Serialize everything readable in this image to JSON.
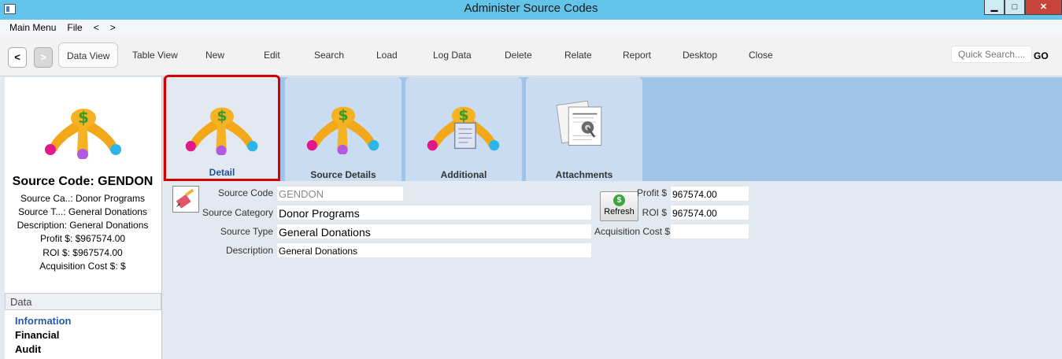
{
  "window": {
    "title": "Administer Source Codes",
    "minimize_glyph": "▁",
    "maximize_glyph": "□",
    "close_glyph": "✕"
  },
  "menubar": {
    "items": [
      "Main Menu",
      "File",
      "<",
      ">"
    ]
  },
  "toolbar": {
    "back_glyph": "<",
    "forward_glyph": ">",
    "data_view": "Data View",
    "table_view": "Table View",
    "new": "New",
    "edit": "Edit",
    "search": "Search",
    "load": "Load",
    "log_data": "Log Data",
    "delete": "Delete",
    "relate": "Relate",
    "report": "Report",
    "desktop": "Desktop",
    "close": "Close",
    "quick_search_placeholder": "Quick Search....",
    "go": "GO"
  },
  "summary": {
    "title": "Source Code: GENDON",
    "lines": [
      "Source Ca..: Donor Programs",
      "Source T...: General Donations",
      "Description: General Donations",
      "Profit $: $967574.00",
      "ROI $: $967574.00",
      "Acquisition Cost $: $"
    ]
  },
  "data_section": {
    "heading": "Data",
    "links": [
      "Information",
      "Financial",
      "Audit"
    ]
  },
  "tabs": [
    "Detail",
    "Source Details",
    "Additional",
    "Attachments"
  ],
  "form": {
    "source_code_label": "Source Code",
    "source_code_value": "GENDON",
    "source_category_label": "Source Category",
    "source_category_value": "Donor Programs",
    "source_type_label": "Source Type",
    "source_type_value": "General Donations",
    "description_label": "Description",
    "description_value": "General Donations",
    "refresh_label": "Refresh",
    "refresh_glyph": "$",
    "profit_label": "Profit $",
    "profit_value": "967574.00",
    "roi_label": "ROI $",
    "roi_value": "967574.00",
    "acq_label": "Acquisition Cost $",
    "acq_value": ""
  },
  "colors": {
    "title_bar": "#62c4e8",
    "tab_strip": "#9fc4e7",
    "selected_tab_border": "#d40000",
    "link_blue": "#2a5a9e"
  }
}
